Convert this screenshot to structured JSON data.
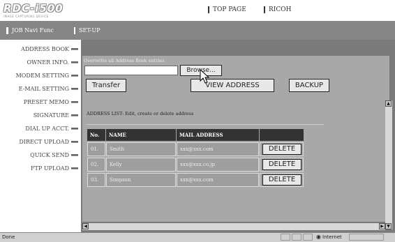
{
  "app": {
    "logo_text": "RDC-i500",
    "logo_tagline": "IMAGE CAPTURING DEVICE"
  },
  "top_links": [
    "TOP PAGE",
    "RICOH"
  ],
  "nav": [
    "JOB Navi Func",
    "SET-UP"
  ],
  "sidebar": {
    "items": [
      {
        "label": "ADDRESS BOOK"
      },
      {
        "label": "OWNER INFO."
      },
      {
        "label": "MODEM SETTING"
      },
      {
        "label": "E-MAIL SETTING"
      },
      {
        "label": "PRESET MEMO"
      },
      {
        "label": "SIGNATURE"
      },
      {
        "label": "DIAL UP ACCT."
      },
      {
        "label": "DIRECT UPLOAD"
      },
      {
        "label": "QUICK SEND"
      },
      {
        "label": "FTP UPLOAD"
      }
    ]
  },
  "form": {
    "overwrite_label": "Overwrite all Address Book entries",
    "file_value": "",
    "browse_label": "Browse...",
    "transfer_label": "Transfer",
    "view_label": "VIEW ADDRESS",
    "backup_label": "BACKUP"
  },
  "address_list": {
    "title": "ADDRESS LIST: Edit, create or delete address",
    "columns": [
      "No.",
      "NAME",
      "MAIL ADDRESS",
      ""
    ],
    "rows": [
      {
        "no": "01.",
        "name": "Smith",
        "mail": "xxx@xxx.com",
        "action": "DELETE"
      },
      {
        "no": "02.",
        "name": "Kelly",
        "mail": "xxx@xxx.co.jp",
        "action": "DELETE"
      },
      {
        "no": "03.",
        "name": "Simpson",
        "mail": "xxx@xxx.com",
        "action": "DELETE"
      }
    ]
  },
  "status": {
    "text": "Done",
    "zone": "Internet"
  },
  "colors": {
    "nav_bar": "#868686",
    "content_bg": "#7a7a7a",
    "panel_bg": "#a8a8a8",
    "table_header": "#333333"
  }
}
